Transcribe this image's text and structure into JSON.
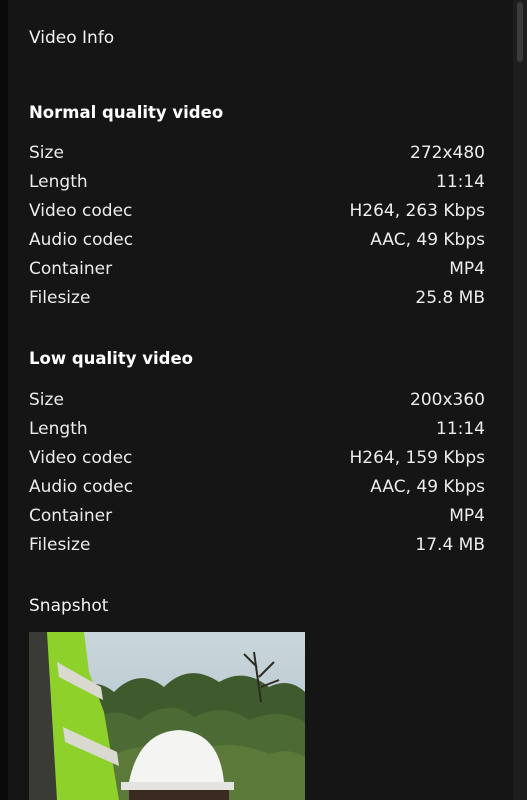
{
  "header": {
    "title": "Video Info"
  },
  "normal": {
    "title": "Normal quality video",
    "rows": [
      {
        "label": "Size",
        "value": "272x480"
      },
      {
        "label": "Length",
        "value": "11:14"
      },
      {
        "label": "Video codec",
        "value": "H264, 263 Kbps"
      },
      {
        "label": "Audio codec",
        "value": "AAC, 49 Kbps"
      },
      {
        "label": "Container",
        "value": "MP4"
      },
      {
        "label": "Filesize",
        "value": "25.8 MB"
      }
    ]
  },
  "low": {
    "title": "Low quality video",
    "rows": [
      {
        "label": "Size",
        "value": "200x360"
      },
      {
        "label": "Length",
        "value": "11:14"
      },
      {
        "label": "Video codec",
        "value": "H264, 159 Kbps"
      },
      {
        "label": "Audio codec",
        "value": "AAC, 49 Kbps"
      },
      {
        "label": "Container",
        "value": "MP4"
      },
      {
        "label": "Filesize",
        "value": "17.4 MB"
      }
    ]
  },
  "snapshot": {
    "label": "Snapshot"
  }
}
